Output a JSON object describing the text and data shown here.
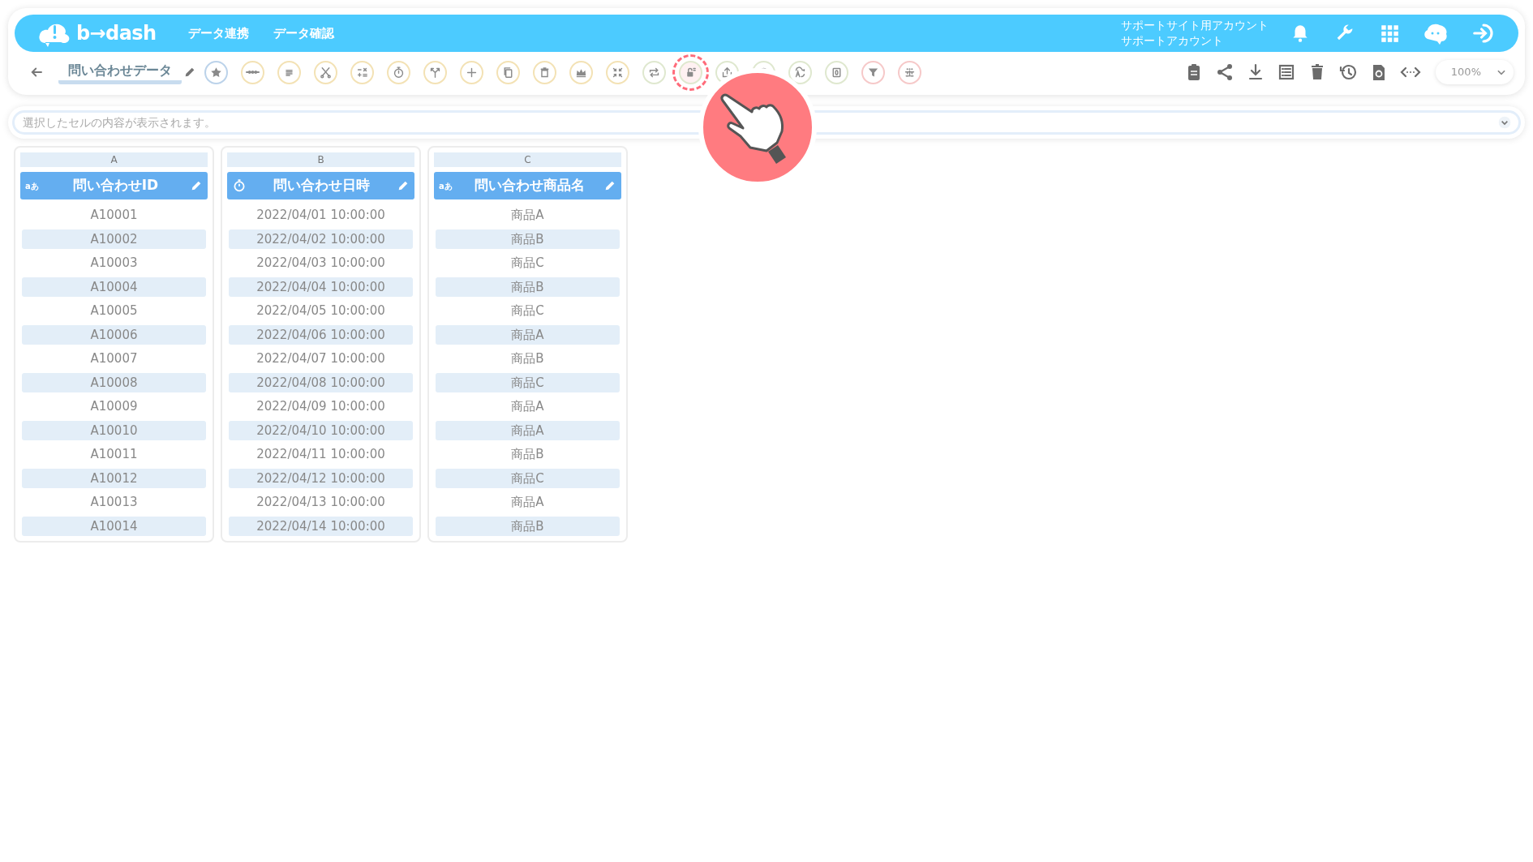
{
  "header": {
    "logo": "b→dash",
    "nav": [
      "データ連携",
      "データ確認"
    ],
    "account": {
      "line_1": "サポートサイト用アカウント",
      "line_2": "サポートアカウント"
    }
  },
  "toolbar": {
    "title": "問い合わせデータ",
    "tools": [
      {
        "color": "#bcd3ea",
        "highlighted": false
      },
      {
        "color": "#f3e2b5",
        "highlighted": false
      },
      {
        "color": "#f3e2b5",
        "highlighted": false
      },
      {
        "color": "#f3e2b5",
        "highlighted": false
      },
      {
        "color": "#f3e2b5",
        "highlighted": false
      },
      {
        "color": "#f3e2b5",
        "highlighted": false
      },
      {
        "color": "#f3e2b5",
        "highlighted": false
      },
      {
        "color": "#f3e2b5",
        "highlighted": false
      },
      {
        "color": "#f3e2b5",
        "highlighted": false
      },
      {
        "color": "#f3e2b5",
        "highlighted": false
      },
      {
        "color": "#f3e2b5",
        "highlighted": false
      },
      {
        "color": "#f3e2b5",
        "highlighted": false
      },
      {
        "color": "#dfe8cf",
        "highlighted": false
      },
      {
        "color": "#dfe8cf",
        "highlighted": true
      },
      {
        "color": "#dfe8cf",
        "highlighted": false
      },
      {
        "color": "#dfe8cf",
        "highlighted": false
      },
      {
        "color": "#dfe8cf",
        "highlighted": false
      },
      {
        "color": "#dfe8cf",
        "highlighted": false
      },
      {
        "color": "#f6c9c9",
        "highlighted": false
      },
      {
        "color": "#f6c9c9",
        "highlighted": false
      }
    ],
    "zoom": "100%"
  },
  "formula_bar": {
    "placeholder": "選択したセルの内容が表示されます。"
  },
  "columns": [
    {
      "letter": "A",
      "kind": "text",
      "type_label": "aあ",
      "name": "問い合わせID",
      "cells": [
        "A10001",
        "A10002",
        "A10003",
        "A10004",
        "A10005",
        "A10006",
        "A10007",
        "A10008",
        "A10009",
        "A10010",
        "A10011",
        "A10012",
        "A10013",
        "A10014"
      ]
    },
    {
      "letter": "B",
      "kind": "datetime",
      "name": "問い合わせ日時",
      "cells": [
        "2022/04/01 10:00:00",
        "2022/04/02 10:00:00",
        "2022/04/03 10:00:00",
        "2022/04/04 10:00:00",
        "2022/04/05 10:00:00",
        "2022/04/06 10:00:00",
        "2022/04/07 10:00:00",
        "2022/04/08 10:00:00",
        "2022/04/09 10:00:00",
        "2022/04/10 10:00:00",
        "2022/04/11 10:00:00",
        "2022/04/12 10:00:00",
        "2022/04/13 10:00:00",
        "2022/04/14 10:00:00"
      ]
    },
    {
      "letter": "C",
      "kind": "text",
      "type_label": "aあ",
      "name": "問い合わせ商品名",
      "cells": [
        "商品A",
        "商品B",
        "商品C",
        "商品B",
        "商品C",
        "商品A",
        "商品B",
        "商品C",
        "商品A",
        "商品A",
        "商品B",
        "商品C",
        "商品A",
        "商品B"
      ]
    }
  ]
}
